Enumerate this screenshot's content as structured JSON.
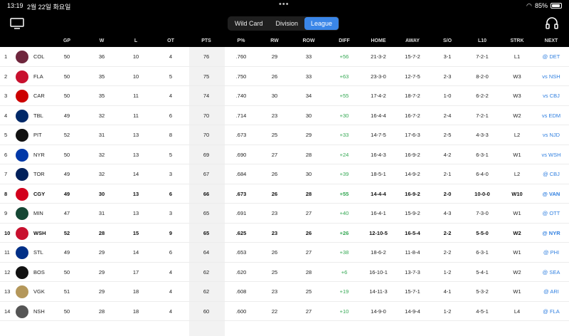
{
  "status_bar": {
    "time": "13:19",
    "date": "2월 22일 화요일",
    "battery": "85%"
  },
  "tabs": [
    {
      "label": "Wild Card",
      "active": false
    },
    {
      "label": "Division",
      "active": false
    },
    {
      "label": "League",
      "active": true
    }
  ],
  "columns": [
    "GP",
    "W",
    "L",
    "OT",
    "PTS",
    "P%",
    "RW",
    "ROW",
    "DIFF",
    "HOME",
    "AWAY",
    "S/O",
    "L10",
    "STRK",
    "NEXT"
  ],
  "teams": [
    {
      "rank": "1",
      "abbr": "COL",
      "logo": "avalanche-logo",
      "color": "#6f263d",
      "gp": "50",
      "w": "36",
      "l": "10",
      "ot": "4",
      "pts": "76",
      "pct": ".760",
      "rw": "29",
      "row": "33",
      "diff": "+56",
      "home": "21-3-2",
      "away": "15-7-2",
      "so": "3-1",
      "l10": "7-2-1",
      "strk": "L1",
      "next": "@ DET",
      "bold": false
    },
    {
      "rank": "2",
      "abbr": "FLA",
      "logo": "panthers-logo",
      "color": "#c8102e",
      "gp": "50",
      "w": "35",
      "l": "10",
      "ot": "5",
      "pts": "75",
      "pct": ".750",
      "rw": "26",
      "row": "33",
      "diff": "+63",
      "home": "23-3-0",
      "away": "12-7-5",
      "so": "2-3",
      "l10": "8-2-0",
      "strk": "W3",
      "next": "vs NSH",
      "bold": false
    },
    {
      "rank": "3",
      "abbr": "CAR",
      "logo": "hurricanes-logo",
      "color": "#cc0000",
      "gp": "50",
      "w": "35",
      "l": "11",
      "ot": "4",
      "pts": "74",
      "pct": ".740",
      "rw": "30",
      "row": "34",
      "diff": "+55",
      "home": "17-4-2",
      "away": "18-7-2",
      "so": "1-0",
      "l10": "6-2-2",
      "strk": "W3",
      "next": "vs CBJ",
      "bold": false
    },
    {
      "rank": "4",
      "abbr": "TBL",
      "logo": "lightning-logo",
      "color": "#002868",
      "gp": "49",
      "w": "32",
      "l": "11",
      "ot": "6",
      "pts": "70",
      "pct": ".714",
      "rw": "23",
      "row": "30",
      "diff": "+30",
      "home": "16-4-4",
      "away": "16-7-2",
      "so": "2-4",
      "l10": "7-2-1",
      "strk": "W2",
      "next": "vs EDM",
      "bold": false
    },
    {
      "rank": "5",
      "abbr": "PIT",
      "logo": "penguins-logo",
      "color": "#111111",
      "gp": "52",
      "w": "31",
      "l": "13",
      "ot": "8",
      "pts": "70",
      "pct": ".673",
      "rw": "25",
      "row": "29",
      "diff": "+33",
      "home": "14-7-5",
      "away": "17-6-3",
      "so": "2-5",
      "l10": "4-3-3",
      "strk": "L2",
      "next": "vs NJD",
      "bold": false
    },
    {
      "rank": "6",
      "abbr": "NYR",
      "logo": "rangers-logo",
      "color": "#0038a8",
      "gp": "50",
      "w": "32",
      "l": "13",
      "ot": "5",
      "pts": "69",
      "pct": ".690",
      "rw": "27",
      "row": "28",
      "diff": "+24",
      "home": "16-4-3",
      "away": "16-9-2",
      "so": "4-2",
      "l10": "6-3-1",
      "strk": "W1",
      "next": "vs WSH",
      "bold": false
    },
    {
      "rank": "7",
      "abbr": "TOR",
      "logo": "maple-leafs-logo",
      "color": "#00205b",
      "gp": "49",
      "w": "32",
      "l": "14",
      "ot": "3",
      "pts": "67",
      "pct": ".684",
      "rw": "26",
      "row": "30",
      "diff": "+39",
      "home": "18-5-1",
      "away": "14-9-2",
      "so": "2-1",
      "l10": "6-4-0",
      "strk": "L2",
      "next": "@ CBJ",
      "bold": false
    },
    {
      "rank": "8",
      "abbr": "CGY",
      "logo": "flames-logo",
      "color": "#d2001c",
      "gp": "49",
      "w": "30",
      "l": "13",
      "ot": "6",
      "pts": "66",
      "pct": ".673",
      "rw": "26",
      "row": "28",
      "diff": "+55",
      "home": "14-4-4",
      "away": "16-9-2",
      "so": "2-0",
      "l10": "10-0-0",
      "strk": "W10",
      "next": "@ VAN",
      "bold": true
    },
    {
      "rank": "9",
      "abbr": "MIN",
      "logo": "wild-logo",
      "color": "#154734",
      "gp": "47",
      "w": "31",
      "l": "13",
      "ot": "3",
      "pts": "65",
      "pct": ".691",
      "rw": "23",
      "row": "27",
      "diff": "+40",
      "home": "16-4-1",
      "away": "15-9-2",
      "so": "4-3",
      "l10": "7-3-0",
      "strk": "W1",
      "next": "@ OTT",
      "bold": false
    },
    {
      "rank": "10",
      "abbr": "WSH",
      "logo": "capitals-logo",
      "color": "#c8102e",
      "gp": "52",
      "w": "28",
      "l": "15",
      "ot": "9",
      "pts": "65",
      "pct": ".625",
      "rw": "23",
      "row": "26",
      "diff": "+26",
      "home": "12-10-5",
      "away": "16-5-4",
      "so": "2-2",
      "l10": "5-5-0",
      "strk": "W2",
      "next": "@ NYR",
      "bold": true
    },
    {
      "rank": "11",
      "abbr": "STL",
      "logo": "blues-logo",
      "color": "#002f87",
      "gp": "49",
      "w": "29",
      "l": "14",
      "ot": "6",
      "pts": "64",
      "pct": ".653",
      "rw": "26",
      "row": "27",
      "diff": "+38",
      "home": "18-6-2",
      "away": "11-8-4",
      "so": "2-2",
      "l10": "6-3-1",
      "strk": "W1",
      "next": "@ PHI",
      "bold": false
    },
    {
      "rank": "12",
      "abbr": "BOS",
      "logo": "bruins-logo",
      "color": "#111111",
      "gp": "50",
      "w": "29",
      "l": "17",
      "ot": "4",
      "pts": "62",
      "pct": ".620",
      "rw": "25",
      "row": "28",
      "diff": "+6",
      "home": "16-10-1",
      "away": "13-7-3",
      "so": "1-2",
      "l10": "5-4-1",
      "strk": "W2",
      "next": "@ SEA",
      "bold": false
    },
    {
      "rank": "13",
      "abbr": "VGK",
      "logo": "golden-knights-logo",
      "color": "#b4975a",
      "gp": "51",
      "w": "29",
      "l": "18",
      "ot": "4",
      "pts": "62",
      "pct": ".608",
      "rw": "23",
      "row": "25",
      "diff": "+19",
      "home": "14-11-3",
      "away": "15-7-1",
      "so": "4-1",
      "l10": "5-3-2",
      "strk": "W1",
      "next": "@ ARI",
      "bold": false
    },
    {
      "rank": "14",
      "abbr": "NSH",
      "logo": "predators-logo",
      "color": "#555555",
      "gp": "50",
      "w": "28",
      "l": "18",
      "ot": "4",
      "pts": "60",
      "pct": ".600",
      "rw": "22",
      "row": "27",
      "diff": "+10",
      "home": "14-9-0",
      "away": "14-9-4",
      "so": "1-2",
      "l10": "4-5-1",
      "strk": "L4",
      "next": "@ FLA",
      "bold": false
    }
  ]
}
